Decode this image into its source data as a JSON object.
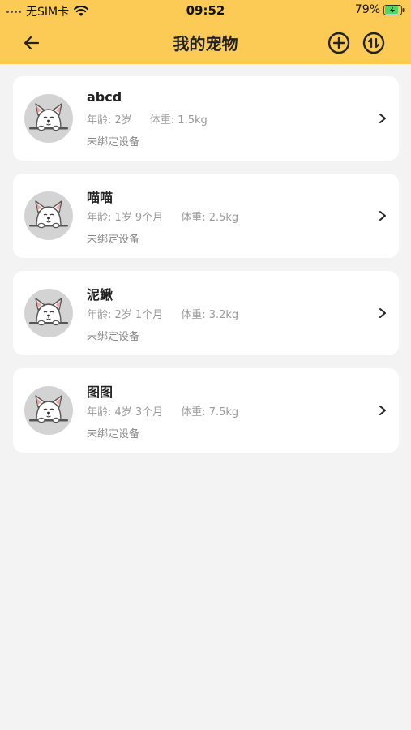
{
  "status_bar": {
    "carrier": "无SIM卡",
    "time": "09:52",
    "battery": "79%"
  },
  "nav": {
    "title": "我的宠物",
    "back_icon": "arrow-left-icon",
    "add_icon": "plus-circle-icon",
    "swap_icon": "swap-vertical-icon"
  },
  "pets": [
    {
      "name": "abcd",
      "age": "年龄: 2岁",
      "weight": "体重: 1.5kg",
      "device": "未绑定设备"
    },
    {
      "name": "喵喵",
      "age": "年龄: 1岁 9个月",
      "weight": "体重: 2.5kg",
      "device": "未绑定设备"
    },
    {
      "name": "泥鳅",
      "age": "年龄: 2岁 1个月",
      "weight": "体重: 3.2kg",
      "device": "未绑定设备"
    },
    {
      "name": "图图",
      "age": "年龄: 4岁 3个月",
      "weight": "体重: 7.5kg",
      "device": "未绑定设备"
    }
  ],
  "colors": {
    "header": "#fbcb55",
    "background": "#f3f3f3",
    "card": "#ffffff",
    "avatar": "#d3d3d3"
  }
}
